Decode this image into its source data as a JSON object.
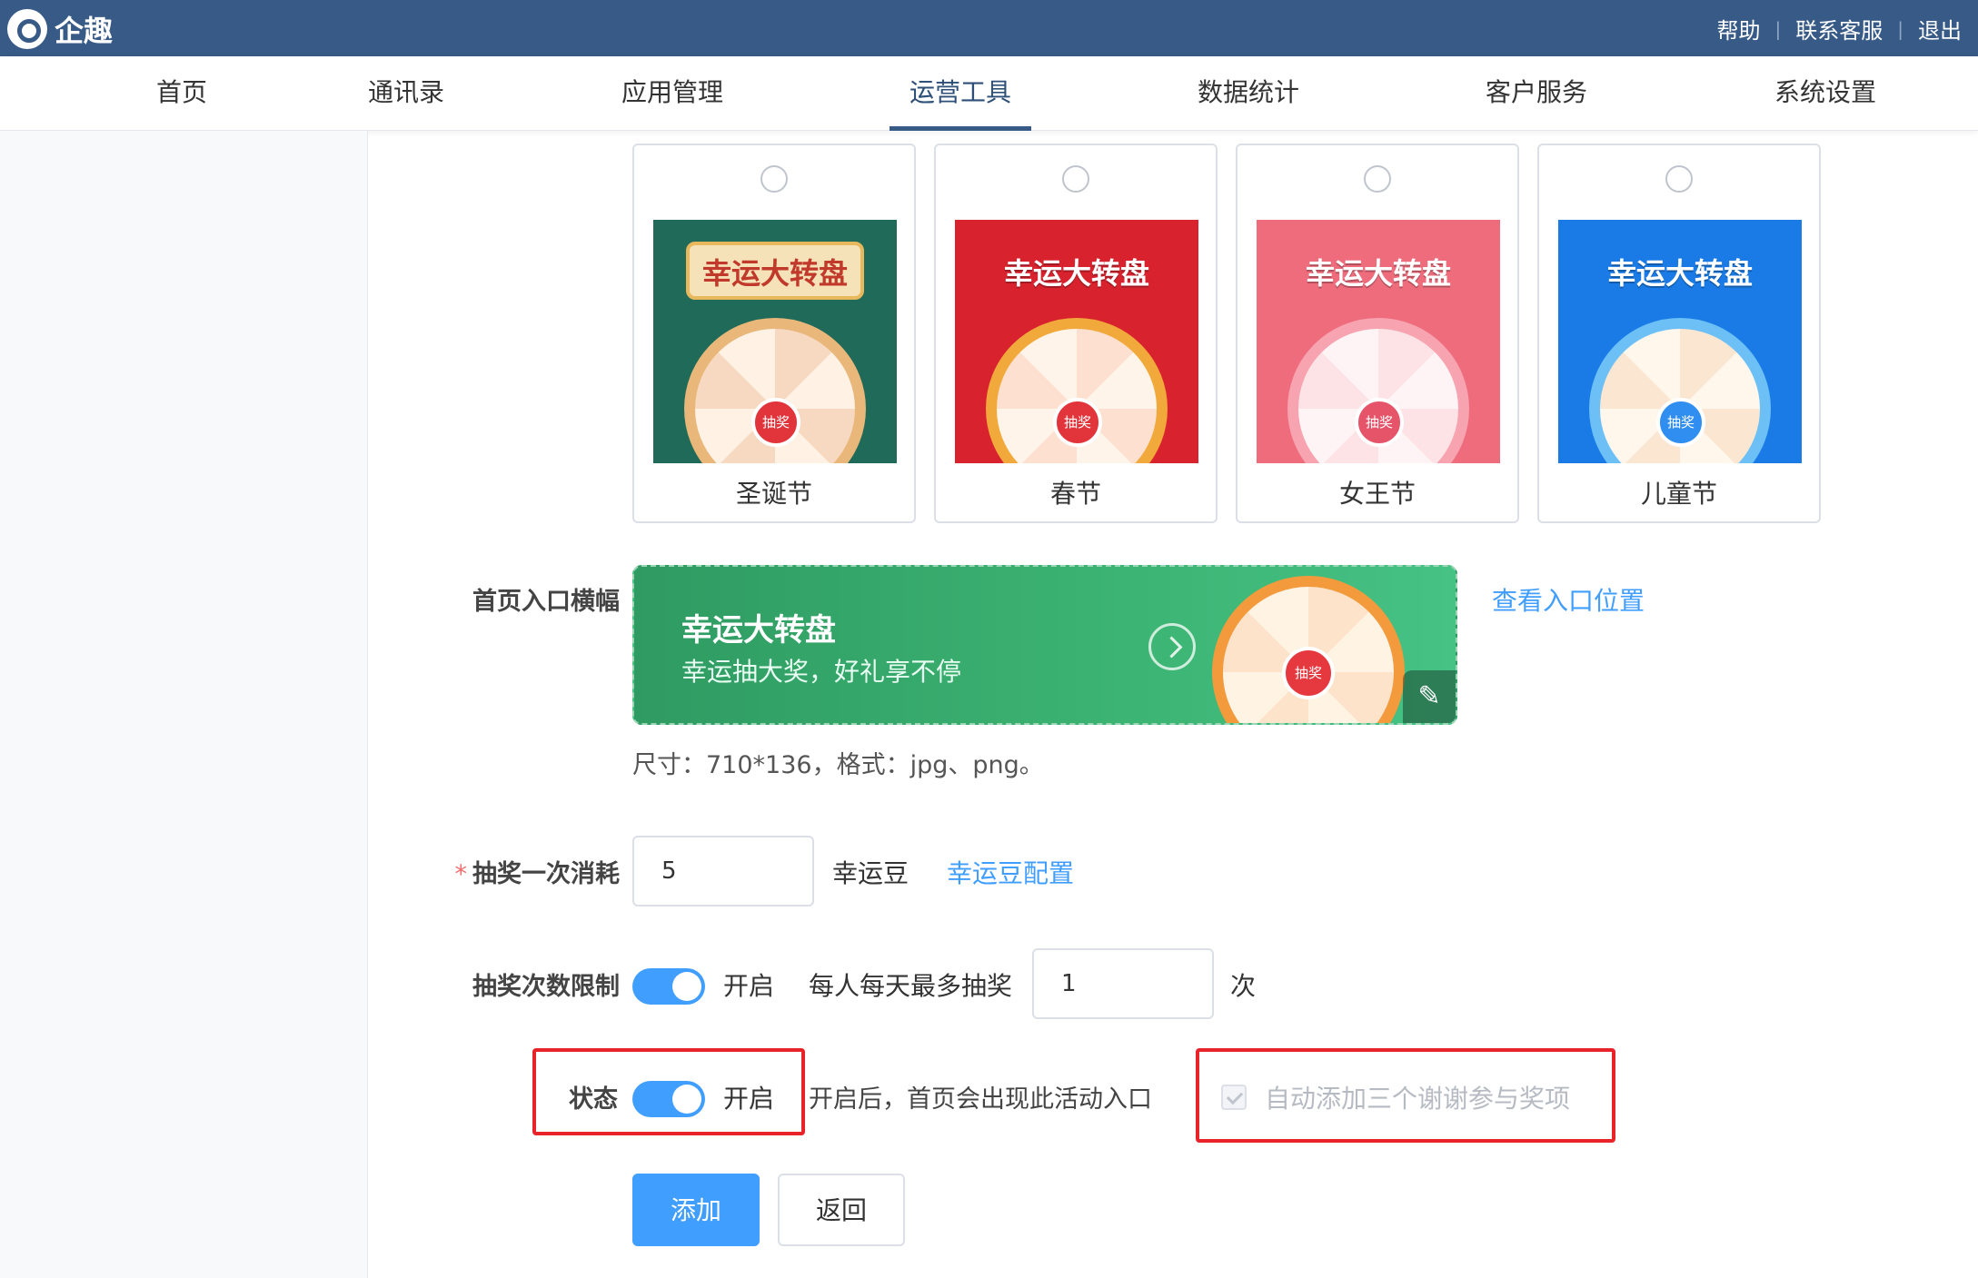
{
  "app": {
    "name": "企趣"
  },
  "toplinks": [
    "帮助",
    "联系客服",
    "退出"
  ],
  "nav": [
    "首页",
    "通讯录",
    "应用管理",
    "运营工具",
    "数据统计",
    "客户服务",
    "系统设置"
  ],
  "nav_active": "运营工具",
  "templates": [
    {
      "label": "圣诞节",
      "thumb_title": "幸运大转盘",
      "hub": "抽奖",
      "theme": "#1f6a58"
    },
    {
      "label": "春节",
      "thumb_title": "幸运大转盘",
      "hub": "抽奖",
      "theme": "#d8232f"
    },
    {
      "label": "女王节",
      "thumb_title": "幸运大转盘",
      "hub": "抽奖",
      "theme": "#ee6c7c"
    },
    {
      "label": "儿童节",
      "thumb_title": "幸运大转盘",
      "hub": "抽奖",
      "theme": "#1a7be6"
    }
  ],
  "entry_banner": {
    "label": "首页入口横幅",
    "title": "幸运大转盘",
    "subtitle": "幸运抽大奖，好礼享不停",
    "hub": "抽奖",
    "view_link": "查看入口位置",
    "size_hint": "尺寸：710*136，格式：jpg、png。"
  },
  "cost": {
    "required_mark": "*",
    "label": "抽奖一次消耗",
    "value": "5",
    "unit": "幸运豆",
    "config_link": "幸运豆配置"
  },
  "limit": {
    "label": "抽奖次数限制",
    "switch_on": true,
    "switch_text": "开启",
    "per_day_text": "每人每天最多抽奖",
    "value": "1",
    "unit": "次"
  },
  "status": {
    "label": "状态",
    "switch_on": true,
    "switch_text": "开启",
    "hint": "开启后，首页会出现此活动入口"
  },
  "auto_add": {
    "checked": true,
    "disabled": true,
    "text": "自动添加三个谢谢参与奖项"
  },
  "buttons": {
    "add": "添加",
    "back": "返回"
  },
  "colors": {
    "topbar": "#375a87",
    "primary": "#409eff",
    "highlight": "#e8232a"
  }
}
